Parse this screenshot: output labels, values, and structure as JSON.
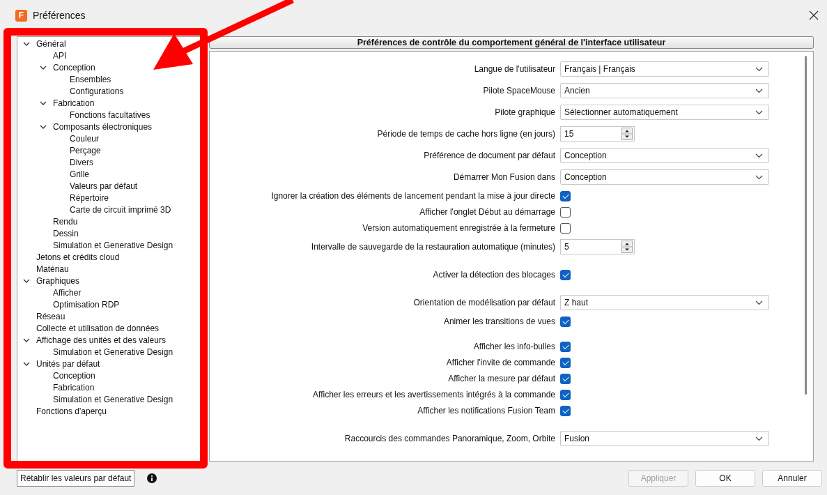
{
  "window": {
    "icon_letter": "F",
    "title": "Préférences"
  },
  "tree": [
    {
      "label": "Général",
      "expanded": true,
      "children": [
        {
          "label": "API"
        },
        {
          "label": "Conception",
          "expanded": true,
          "children": [
            {
              "label": "Ensembles"
            },
            {
              "label": "Configurations"
            }
          ]
        },
        {
          "label": "Fabrication",
          "expanded": true,
          "children": [
            {
              "label": "Fonctions facultatives"
            }
          ]
        },
        {
          "label": "Composants électroniques",
          "expanded": true,
          "children": [
            {
              "label": "Couleur"
            },
            {
              "label": "Perçage"
            },
            {
              "label": "Divers"
            },
            {
              "label": "Grille"
            },
            {
              "label": "Valeurs par défaut"
            },
            {
              "label": "Répertoire"
            },
            {
              "label": "Carte de circuit imprimé 3D"
            }
          ]
        },
        {
          "label": "Rendu"
        },
        {
          "label": "Dessin"
        },
        {
          "label": "Simulation et Generative Design"
        }
      ]
    },
    {
      "label": "Jetons et crédits cloud"
    },
    {
      "label": "Matériau"
    },
    {
      "label": "Graphiques",
      "expanded": true,
      "children": [
        {
          "label": "Afficher"
        },
        {
          "label": "Optimisation RDP"
        }
      ]
    },
    {
      "label": "Réseau"
    },
    {
      "label": "Collecte et utilisation de données"
    },
    {
      "label": "Affichage des unités et des valeurs",
      "expanded": true,
      "children": [
        {
          "label": "Simulation et Generative Design"
        }
      ]
    },
    {
      "label": "Unités par défaut",
      "expanded": true,
      "children": [
        {
          "label": "Conception"
        },
        {
          "label": "Fabrication"
        },
        {
          "label": "Simulation et Generative Design"
        }
      ]
    },
    {
      "label": "Fonctions d'aperçu"
    }
  ],
  "panel_title": "Préférences de contrôle du comportement général de l'interface utilisateur",
  "sections": [
    {
      "rows": [
        {
          "kind": "select",
          "label": "Langue de l'utilisateur",
          "value": "Français | Français"
        },
        {
          "kind": "select",
          "label": "Pilote SpaceMouse",
          "value": "Ancien"
        },
        {
          "kind": "select",
          "label": "Pilote graphique",
          "value": "Sélectionner automatiquement"
        },
        {
          "kind": "spin",
          "label": "Période de temps de cache hors ligne (en jours)",
          "value": "15"
        },
        {
          "kind": "select",
          "label": "Préférence de document par défaut",
          "value": "Conception"
        },
        {
          "kind": "select",
          "label": "Démarrer Mon Fusion dans",
          "value": "Conception"
        },
        {
          "kind": "checkbox",
          "label": "Ignorer la création des éléments de lancement pendant la mise à jour directe",
          "checked": true
        },
        {
          "kind": "checkbox",
          "label": "Afficher l'onglet Début au démarrage",
          "checked": false
        },
        {
          "kind": "checkbox",
          "label": "Version automatiquement enregistrée à la fermeture",
          "checked": false
        },
        {
          "kind": "spin",
          "label": "Intervalle de sauvegarde de la restauration automatique (minutes)",
          "value": "5"
        }
      ]
    },
    {
      "rows": [
        {
          "kind": "checkbox",
          "label": "Activer la détection des blocages",
          "checked": true
        }
      ]
    },
    {
      "rows": [
        {
          "kind": "select",
          "label": "Orientation de modélisation par défaut",
          "value": "Z haut"
        },
        {
          "kind": "checkbox",
          "label": "Animer les transitions de vues",
          "checked": true
        }
      ]
    },
    {
      "rows": [
        {
          "kind": "checkbox",
          "label": "Afficher les info-bulles",
          "checked": true
        },
        {
          "kind": "checkbox",
          "label": "Afficher l'invite de commande",
          "checked": true
        },
        {
          "kind": "checkbox",
          "label": "Afficher la mesure par défaut",
          "checked": true
        },
        {
          "kind": "checkbox",
          "label": "Afficher les erreurs et les avertissements intégrés à la commande",
          "checked": true
        },
        {
          "kind": "checkbox",
          "label": "Afficher les notifications Fusion Team",
          "checked": true
        }
      ]
    },
    {
      "rows": [
        {
          "kind": "select",
          "label": "Raccourcis des commandes Panoramique, Zoom, Orbite",
          "value": "Fusion"
        }
      ]
    }
  ],
  "footer": {
    "reset_button": "Rétablir les valeurs par défaut",
    "buttons": [
      {
        "label": "Appliquer",
        "disabled": true
      },
      {
        "label": "OK",
        "disabled": false
      },
      {
        "label": "Annuler",
        "disabled": false
      }
    ]
  }
}
